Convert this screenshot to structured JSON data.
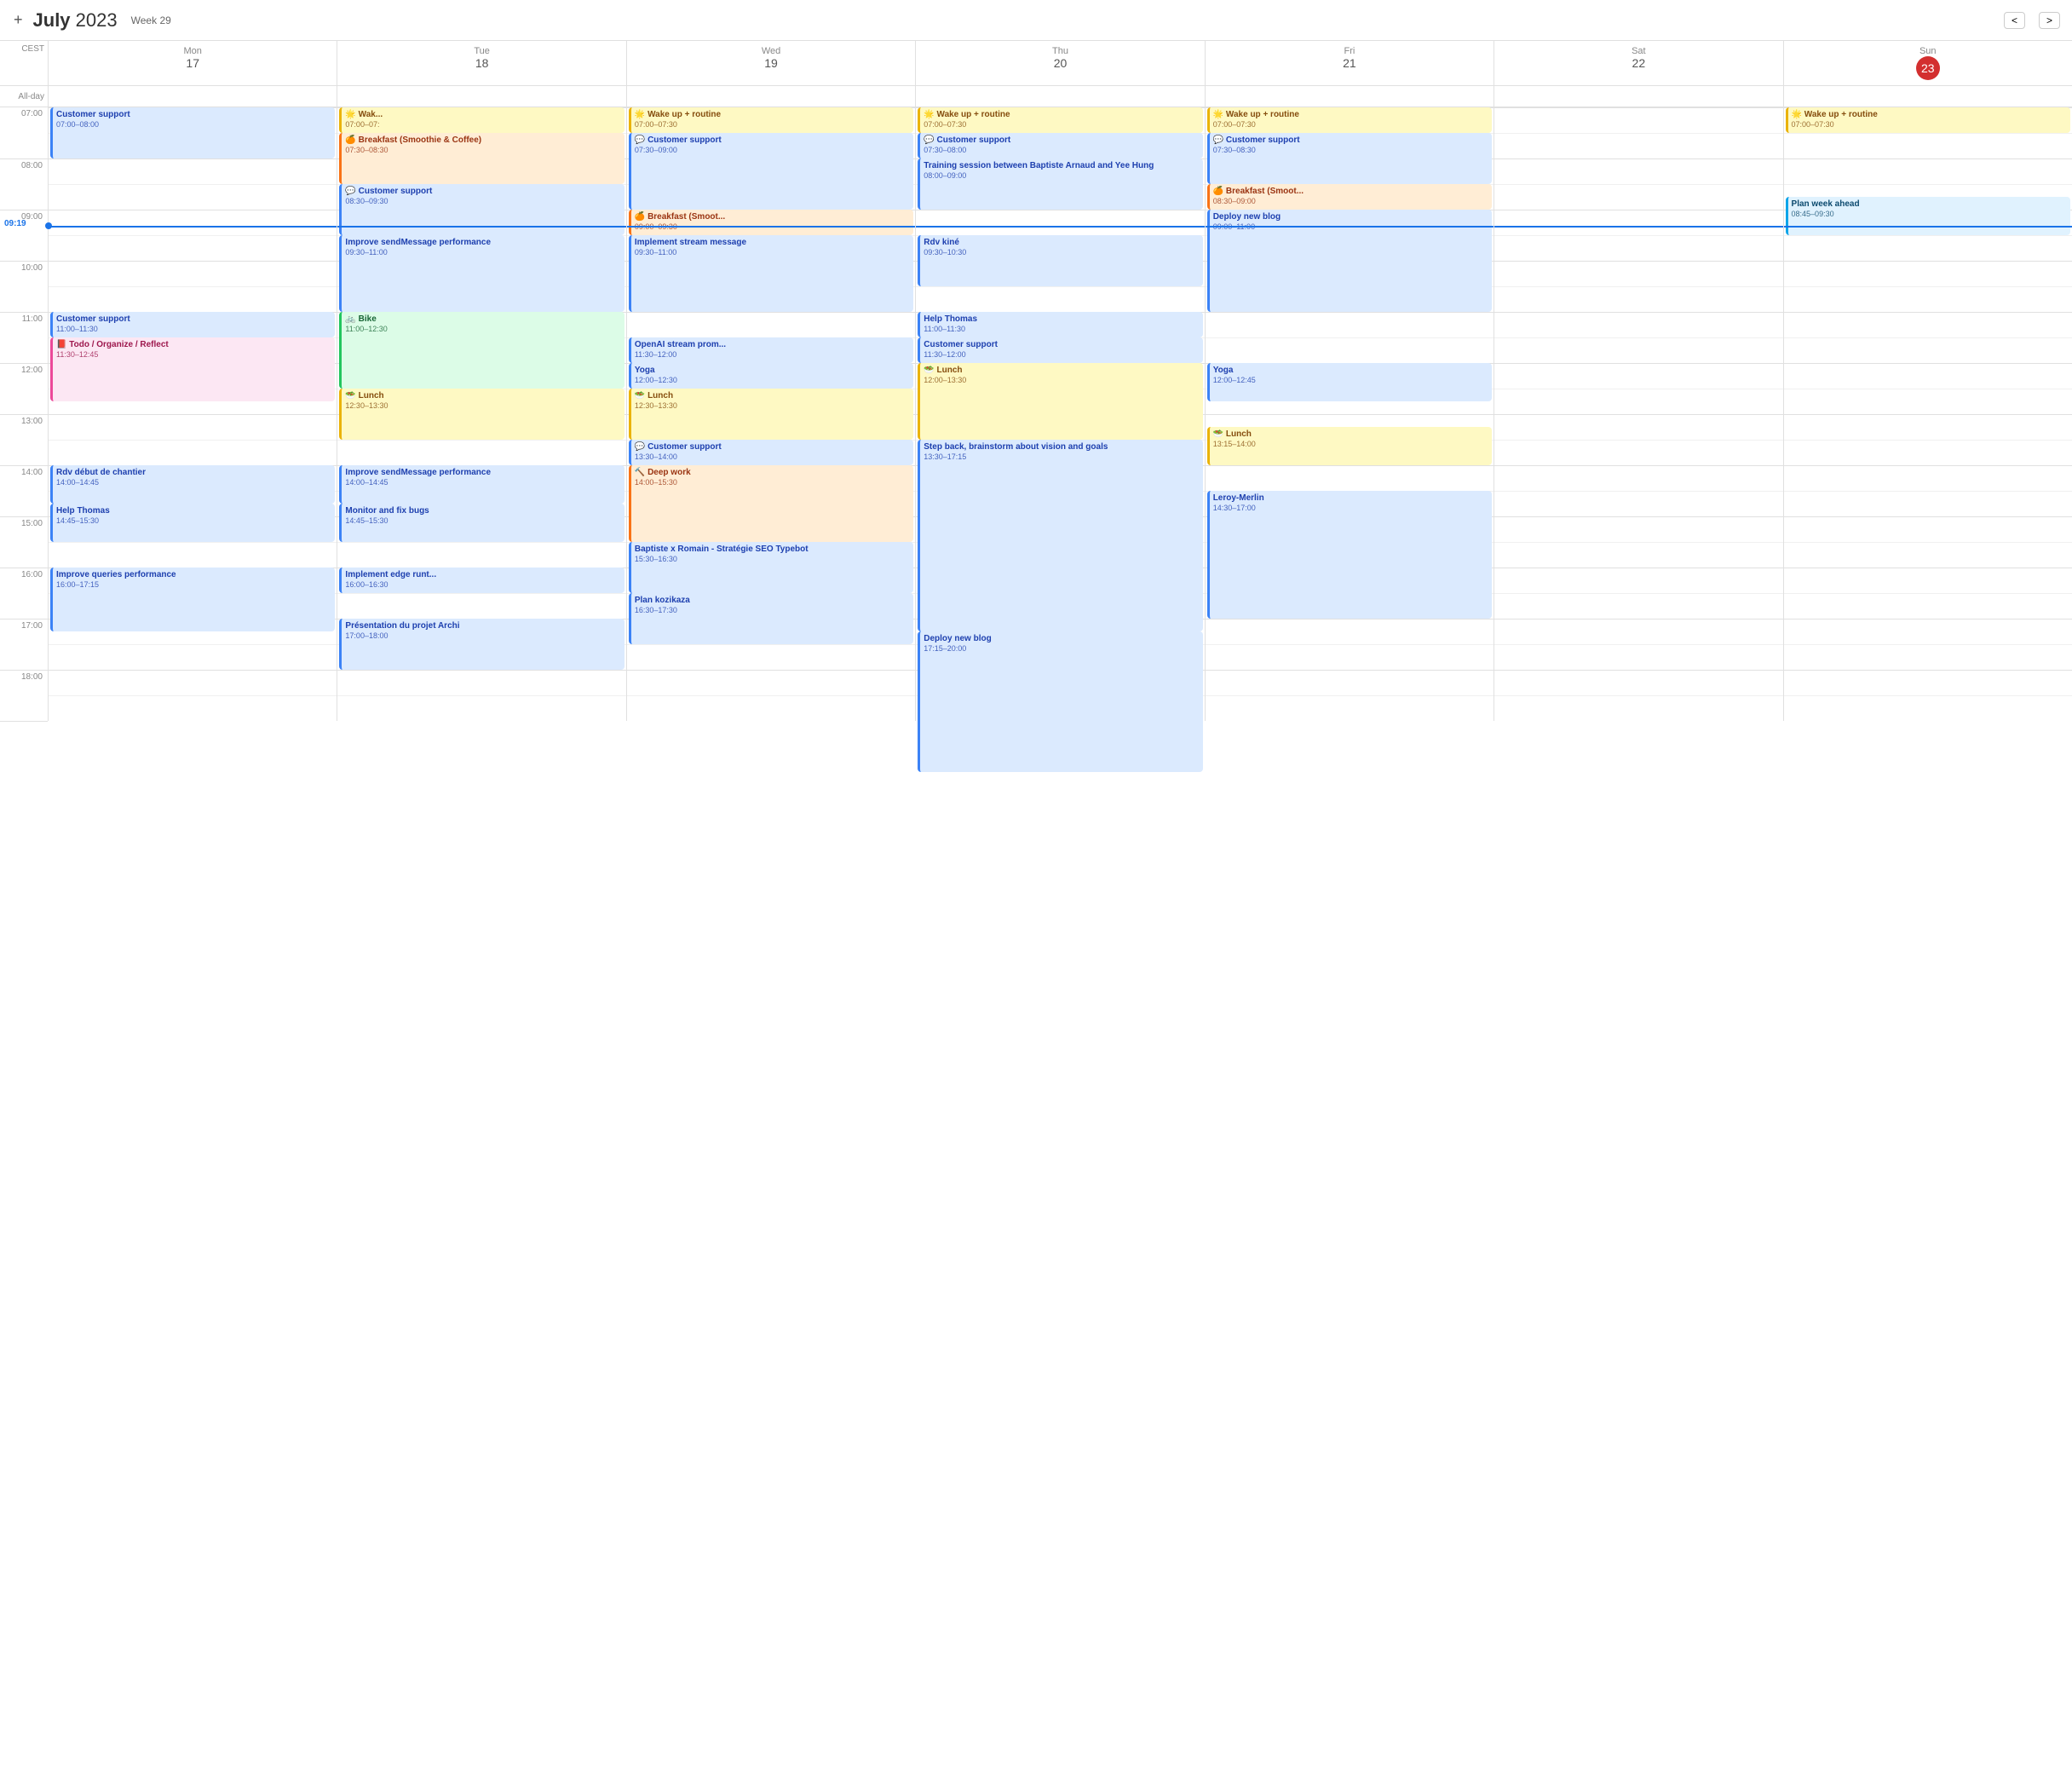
{
  "header": {
    "month": "July",
    "year": "2023",
    "week_label": "Week",
    "week_num": "29",
    "add_icon": "+",
    "tz_label": "CEST",
    "current_time": "09:19"
  },
  "columns": [
    {
      "id": "mon17",
      "day_name": "Mon",
      "day_num": "17",
      "is_today": false
    },
    {
      "id": "tue18",
      "day_name": "Tue",
      "day_num": "18",
      "is_today": false
    },
    {
      "id": "wed19",
      "day_name": "Wed",
      "day_num": "19",
      "is_today": false
    },
    {
      "id": "thu20",
      "day_name": "Thu",
      "day_num": "20",
      "is_today": false
    },
    {
      "id": "fri21",
      "day_name": "Fri",
      "day_num": "21",
      "is_today": false
    },
    {
      "id": "sat22",
      "day_name": "Sat",
      "day_num": "22",
      "is_today": false
    },
    {
      "id": "sun23",
      "day_name": "Sun",
      "day_num": "23",
      "is_today": true
    }
  ],
  "hours": [
    "07:00",
    "08:00",
    "09:00",
    "10:00",
    "11:00",
    "12:00",
    "13:00",
    "14:00",
    "15:00",
    "16:00",
    "17:00"
  ],
  "events": {
    "mon17": [
      {
        "title": "Customer support",
        "time": "07:00–08:00",
        "start_min": 0,
        "dur_min": 60,
        "color": "ev-blue"
      },
      {
        "title": "Customer support",
        "time": "11:00–11:30",
        "start_min": 240,
        "dur_min": 30,
        "color": "ev-blue"
      },
      {
        "title": "📕 Todo / Organize / Reflect",
        "time": "11:30–12:45",
        "start_min": 270,
        "dur_min": 75,
        "color": "ev-pink"
      },
      {
        "title": "Rdv début de chantier",
        "time": "14:00–14:45",
        "start_min": 420,
        "dur_min": 45,
        "color": "ev-blue"
      },
      {
        "title": "Help Thomas",
        "time": "14:45–15:30",
        "start_min": 465,
        "dur_min": 45,
        "color": "ev-blue"
      },
      {
        "title": "Improve queries performance",
        "time": "16:00–17:15",
        "start_min": 540,
        "dur_min": 75,
        "color": "ev-blue"
      }
    ],
    "tue18": [
      {
        "title": "🌟 Wak...",
        "time": "07:00–07:",
        "start_min": 0,
        "dur_min": 30,
        "color": "ev-yellow"
      },
      {
        "title": "🍊 Breakfast (Smoothie & Coffee)",
        "time": "07:30–08:30",
        "start_min": 30,
        "dur_min": 60,
        "color": "ev-orange"
      },
      {
        "title": "💬 Customer support",
        "time": "08:30–09:30",
        "start_min": 90,
        "dur_min": 60,
        "color": "ev-blue"
      },
      {
        "title": "Improve sendMessage performance",
        "time": "09:30–11:00",
        "start_min": 150,
        "dur_min": 90,
        "color": "ev-blue"
      },
      {
        "title": "🚲 Bike",
        "time": "11:00–12:30",
        "start_min": 240,
        "dur_min": 90,
        "color": "ev-green"
      },
      {
        "title": "🥗 Lunch",
        "time": "12:30–13:30",
        "start_min": 330,
        "dur_min": 60,
        "color": "ev-yellow"
      },
      {
        "title": "Improve sendMessage performance",
        "time": "14:00–14:45",
        "start_min": 420,
        "dur_min": 45,
        "color": "ev-blue"
      },
      {
        "title": "Monitor and fix bugs",
        "time": "14:45–15:30",
        "start_min": 465,
        "dur_min": 45,
        "color": "ev-blue"
      },
      {
        "title": "Implement edge runt...",
        "time": "16:00–16:30",
        "start_min": 540,
        "dur_min": 30,
        "color": "ev-blue"
      },
      {
        "title": "Présentation du projet Archi",
        "time": "17:00–18:00",
        "start_min": 600,
        "dur_min": 60,
        "color": "ev-blue"
      }
    ],
    "wed19": [
      {
        "title": "🌟 Wake up + routine",
        "time": "07:00–07:30",
        "start_min": 0,
        "dur_min": 30,
        "color": "ev-yellow"
      },
      {
        "title": "💬 Customer support",
        "time": "07:30–09:00",
        "start_min": 30,
        "dur_min": 90,
        "color": "ev-blue"
      },
      {
        "title": "🍊 Breakfast (Smoot...",
        "time": "09:00–09:30",
        "start_min": 120,
        "dur_min": 30,
        "color": "ev-orange"
      },
      {
        "title": "Implement stream message",
        "time": "09:30–11:00",
        "start_min": 150,
        "dur_min": 90,
        "color": "ev-blue"
      },
      {
        "title": "OpenAI stream prom...",
        "time": "11:30–12:00",
        "start_min": 270,
        "dur_min": 30,
        "color": "ev-blue"
      },
      {
        "title": "Yoga",
        "time": "12:00–12:30",
        "start_min": 300,
        "dur_min": 30,
        "color": "ev-blue"
      },
      {
        "title": "🥗 Lunch",
        "time": "12:30–13:30",
        "start_min": 330,
        "dur_min": 60,
        "color": "ev-yellow"
      },
      {
        "title": "💬 Customer support",
        "time": "13:30–14:00",
        "start_min": 390,
        "dur_min": 30,
        "color": "ev-blue"
      },
      {
        "title": "🔨 Deep work",
        "time": "14:00–15:30",
        "start_min": 420,
        "dur_min": 90,
        "color": "ev-orange"
      },
      {
        "title": "Baptiste x Romain - Stratégie SEO Typebot",
        "time": "15:30–16:30",
        "start_min": 510,
        "dur_min": 60,
        "color": "ev-blue"
      },
      {
        "title": "Plan kozikaza",
        "time": "16:30–17:30",
        "start_min": 570,
        "dur_min": 60,
        "color": "ev-blue"
      }
    ],
    "thu20": [
      {
        "title": "🌟 Wake up + routine",
        "time": "07:00–07:30",
        "start_min": 0,
        "dur_min": 30,
        "color": "ev-yellow"
      },
      {
        "title": "💬 Customer support",
        "time": "07:30–08:00",
        "start_min": 30,
        "dur_min": 30,
        "color": "ev-blue"
      },
      {
        "title": "Training session between Baptiste Arnaud and Yee Hung",
        "time": "08:00–09:00",
        "start_min": 60,
        "dur_min": 60,
        "color": "ev-blue"
      },
      {
        "title": "Rdv kiné",
        "time": "09:30–10:30",
        "start_min": 150,
        "dur_min": 60,
        "color": "ev-blue"
      },
      {
        "title": "Help Thomas",
        "time": "11:00–11:30",
        "start_min": 240,
        "dur_min": 30,
        "color": "ev-blue"
      },
      {
        "title": "Customer support",
        "time": "11:30–12:00",
        "start_min": 270,
        "dur_min": 30,
        "color": "ev-blue"
      },
      {
        "title": "🥗 Lunch",
        "time": "12:00–13:30",
        "start_min": 300,
        "dur_min": 90,
        "color": "ev-yellow"
      },
      {
        "title": "Step back, brainstorm about vision and goals",
        "time": "13:30–17:15",
        "start_min": 390,
        "dur_min": 225,
        "color": "ev-blue"
      },
      {
        "title": "Deploy new blog",
        "time": "17:15–20:00",
        "start_min": 615,
        "dur_min": 165,
        "color": "ev-blue"
      }
    ],
    "fri21": [
      {
        "title": "🌟 Wake up + routine",
        "time": "07:00–07:30",
        "start_min": 0,
        "dur_min": 30,
        "color": "ev-yellow"
      },
      {
        "title": "💬 Customer support",
        "time": "07:30–08:30",
        "start_min": 30,
        "dur_min": 60,
        "color": "ev-blue"
      },
      {
        "title": "🍊 Breakfast (Smoot...",
        "time": "08:30–09:00",
        "start_min": 90,
        "dur_min": 30,
        "color": "ev-orange"
      },
      {
        "title": "Deploy new blog",
        "time": "09:00–11:00",
        "start_min": 120,
        "dur_min": 120,
        "color": "ev-blue"
      },
      {
        "title": "Yoga",
        "time": "12:00–12:45",
        "start_min": 300,
        "dur_min": 45,
        "color": "ev-blue"
      },
      {
        "title": "🥗 Lunch",
        "time": "13:15–14:00",
        "start_min": 375,
        "dur_min": 45,
        "color": "ev-yellow"
      },
      {
        "title": "Leroy-Merlin",
        "time": "14:30–17:00",
        "start_min": 450,
        "dur_min": 150,
        "color": "ev-blue"
      }
    ],
    "sat22": [],
    "sun23": [
      {
        "title": "🌟 Wake up + routine",
        "time": "07:00–07:30",
        "start_min": 0,
        "dur_min": 30,
        "color": "ev-yellow"
      },
      {
        "title": "Plan week ahead",
        "time": "08:45–09:30",
        "start_min": 105,
        "dur_min": 45,
        "color": "ev-lightblue"
      }
    ]
  }
}
